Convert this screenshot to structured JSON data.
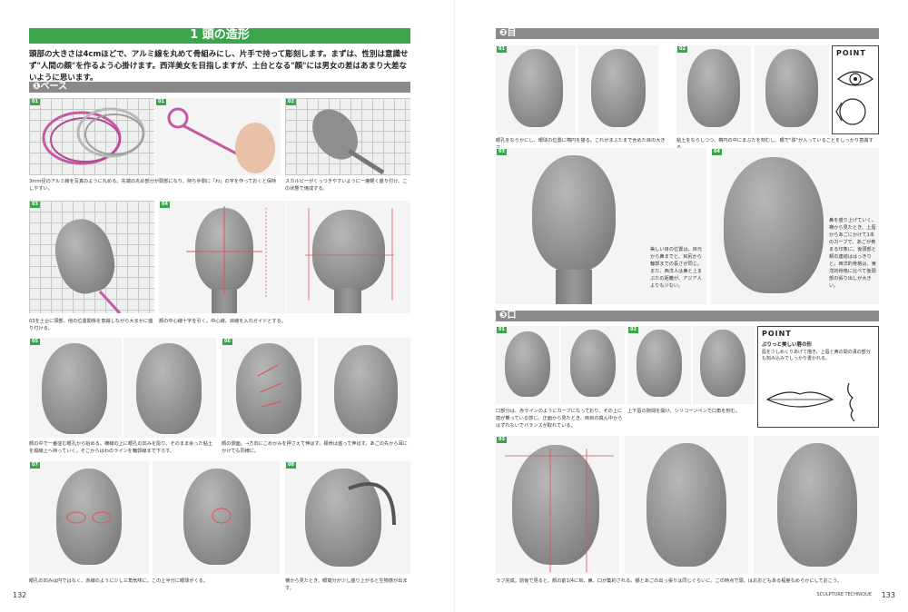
{
  "left": {
    "title": "1 頭の造形",
    "intro": "頭部の大きさは4cmほどで、アルミ線を丸めて骨組みにし、片手で持って彫刻します。まずは、性別は意識せず\"人間の顔\"を作るよう心掛けます。西洋美女を目指しますが、土台となる\"顔\"には男女の差はあまり大差ないように思います。",
    "section": "❶ベース",
    "tags": [
      "01",
      "01",
      "02",
      "03",
      "04",
      "05",
      "06",
      "07",
      "08"
    ],
    "captions": {
      "c1": "3mm径のアルミ線を写真のように丸める。先端の丸め部分が頭部になり、持ち手側に「わ」の字を作っておくと保持しやすい。",
      "c2": "スカルピーがくっつきやすいように一度軽く盛り付け、この状態で焼成する。",
      "c3": "03を土台に頭部、他の位置関係を意識しながら大まかに盛り付ける。",
      "c4": "顔の中心線十字を引く。中心線、目線を入れガイドとする。",
      "c5": "顔の中で一番窪む眼孔から始める。横線の上に眼孔の凹みを彫り、そのまま余った粘土を縦線上へ持っていく。そこからはわのラインを輪郭線まで下ろす。",
      "c6": "顔の側面。→方向にこめかみを押さえて伸ばす。頬骨は盛って伸ばす。あごの先から耳にかけても同様に。",
      "c7": "眼孔の凹みは円ではなく、赤線のように少し三角気味に。この上半分に眼球がくる。",
      "c8": "横から見たとき、眼窩分が少し盛り上がると生物感が出ます。"
    },
    "page_number": "132"
  },
  "right": {
    "section_eye": "❷目",
    "section_mouth": "❸口",
    "tags": [
      "01",
      "02",
      "03",
      "04",
      "01",
      "02",
      "03"
    ],
    "captions": {
      "e1": "眼孔をならかにし、眼球の位置に楕円を描る。これがまぶたまで含めた目の大きさ。",
      "e2": "粘土をならしつつ、楕円の中にまぶたを刻むし、眼で\"球\"が入っていることをしっかり意識する。",
      "e3": "美しい目の位置は、目元から鼻までと、目尻から輪郭までの長さが同じ。また、西洋人は鼻と上まぶたの距離が、アジア人よりも少ない。",
      "e4": "鼻を盛り上げていく。横から見たとき、上唇からあごにかけて1本のカーブで、あごが奥まる印象に。後頭部と頬の連結ははっきりと。西洋的骨格は、東洋的骨格に比べて後頭部の張り出しが大きい。",
      "m1": "口部分は、赤ラインのようにカーブになっており、その上に歯が乗っている感じ。正面から見たとき、両目の真ん中からはずれないでバランスが取れている。",
      "m2": "上下唇の隙間を開け、シリコーンペンで口角を刻む。",
      "m3": "ラフ完成。前後で見ると、顔の前1/4に目、鼻、口が集約される。額とあごの出っ張りは同じぐらいに。この時点で頭、はおおどもある程度なめらかにしておこう。"
    },
    "point1": {
      "title": "POINT"
    },
    "point2": {
      "title": "POINT",
      "subtitle": "ぷりっと美しい唇の形",
      "text": "唇を少しめくりあげて描き、上唇と鼻の間の溝の部分も刻み込みでしっかり書かれる。"
    },
    "footer": "SCULPTURE TECHNIQUE",
    "page_number": "133"
  }
}
